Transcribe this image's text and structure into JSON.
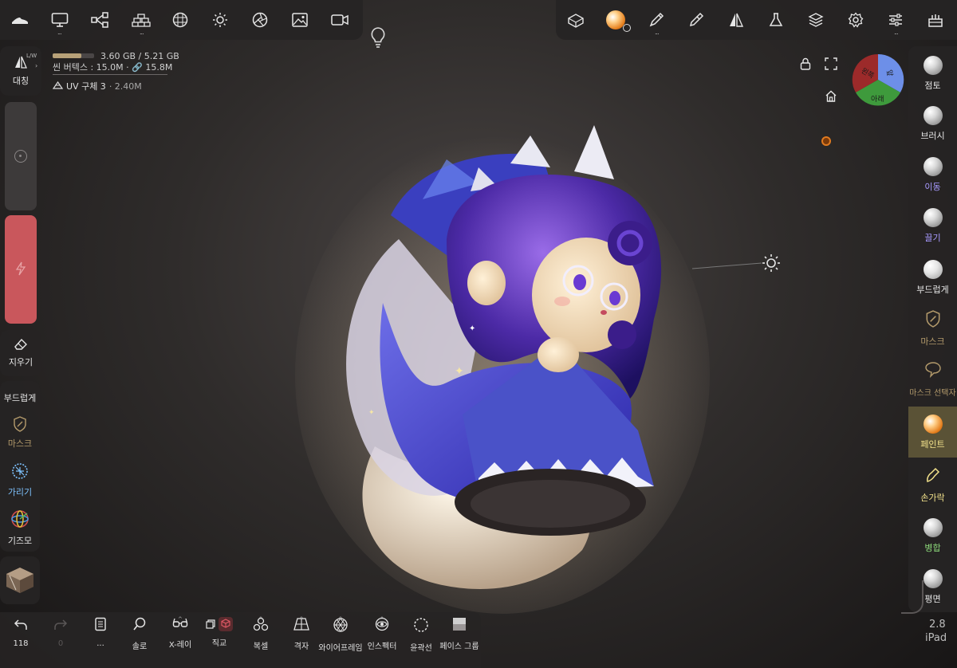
{
  "top_left_toolbar": {
    "items": [
      {
        "icon": "shoe-icon",
        "more": false
      },
      {
        "icon": "monitor-icon",
        "more": true
      },
      {
        "icon": "node-graph-icon",
        "more": false
      },
      {
        "icon": "brick-stack-icon",
        "more": true
      },
      {
        "icon": "mesh-sphere-icon",
        "more": false
      },
      {
        "icon": "sun-icon",
        "more": false
      },
      {
        "icon": "aperture-icon",
        "more": false
      },
      {
        "icon": "image-icon",
        "more": false
      },
      {
        "icon": "video-camera-icon",
        "more": false
      }
    ],
    "more_glyph": "..."
  },
  "top_right_toolbar": {
    "items": [
      "eraser-box-icon",
      "material-ball-icon",
      "pen-icon",
      "dropper-icon",
      "symmetry-icon",
      "flask-icon",
      "layers-icon",
      "gear-icon",
      "sliders-icon",
      "cake-icon"
    ],
    "more_glyph": "..."
  },
  "stats": {
    "memory": "3.60 GB / 5.21 GB",
    "memory_fraction": 0.69,
    "vertices": "씬 버텍스 : 15.0M · 🔗 15.8M",
    "mesh_name": "UV 구체 3",
    "mesh_count": "· 2.40M"
  },
  "left_panel": {
    "symmetry_label": "대칭",
    "symmetry_badge": "L/W",
    "eraser_label": "지우기",
    "smooth_label": "부드럽게",
    "mask_label": "마스크",
    "hide_label": "가리기",
    "gizmo_label": "기즈모",
    "slider_top_value": 0.5,
    "slider_bottom_value": 1.0
  },
  "right_panel": {
    "tools": [
      {
        "label": "점토",
        "color": "#e6e6e6"
      },
      {
        "label": "브러시",
        "color": "#e6e6e6"
      },
      {
        "label": "이동",
        "color": "#a89aff"
      },
      {
        "label": "끌기",
        "color": "#a89aff"
      },
      {
        "label": "부드럽게",
        "color": "#e6e6e6"
      },
      {
        "label": "마스크",
        "color": "#b39a6b"
      },
      {
        "label": "마스크 선택자",
        "color": "#b39a6b"
      },
      {
        "label": "페인트",
        "color": "#f3e28b"
      },
      {
        "label": "손가락",
        "color": "#f3e28b"
      },
      {
        "label": "병합",
        "color": "#8cd97a"
      },
      {
        "label": "평면",
        "color": "#e6e6e6"
      }
    ],
    "active_index": 7
  },
  "view_cube": {
    "left_face": "왼쪽",
    "right_face": "앞",
    "bottom_face": "아래",
    "colors": {
      "left": "#9c2a2a",
      "right": "#6d8fe8",
      "bottom": "#3e9a3c"
    }
  },
  "bottom_bar": {
    "items": [
      {
        "icon": "undo-icon",
        "label": "118",
        "caret": false
      },
      {
        "icon": "redo-icon",
        "label": "0",
        "caret": false,
        "dim": true
      },
      {
        "icon": "notebook-icon",
        "label": "...",
        "caret": false
      },
      {
        "icon": "search-icon",
        "label": "솔로",
        "caret": false
      },
      {
        "icon": "glasses-icon",
        "label": "X-레이",
        "caret": true
      },
      {
        "icon": "ortho-cube-icon",
        "label": "직교",
        "caret": false
      },
      {
        "icon": "spheres-icon",
        "label": "복셀",
        "caret": true
      },
      {
        "icon": "grid-icon",
        "label": "격자",
        "caret": true
      },
      {
        "icon": "wireframe-sphere-icon",
        "label": "와이어프레임",
        "caret": true
      },
      {
        "icon": "inspector-eye-icon",
        "label": "인스펙터",
        "caret": true
      },
      {
        "icon": "dotted-circle-icon",
        "label": "윤곽선",
        "caret": false
      },
      {
        "icon": "face-group-icon",
        "label": "페이스 그룹",
        "caret": false
      }
    ]
  },
  "device": {
    "version": "2.8",
    "name": "iPad"
  },
  "colors": {
    "panel": "#262424",
    "accent_red": "#c9575c",
    "active_tool_bg": "#5a5236"
  }
}
